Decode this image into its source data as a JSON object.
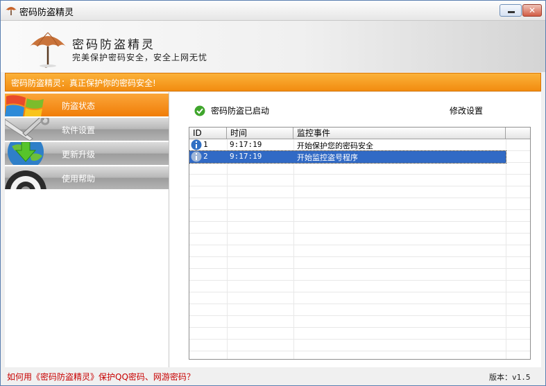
{
  "window": {
    "title": "密码防盗精灵"
  },
  "banner": {
    "title": "密码防盗精灵",
    "subtitle": "完美保护密码安全，安全上网无忧"
  },
  "notice_bar": {
    "text": "密码防盗精灵：真正保护你的密码安全!"
  },
  "sidebar": {
    "items": [
      {
        "label": "防盗状态",
        "active": true,
        "icon": "windows-flag-icon"
      },
      {
        "label": "软件设置",
        "active": false,
        "icon": "tools-wrench-icon"
      },
      {
        "label": "更新升级",
        "active": false,
        "icon": "globe-download-icon"
      },
      {
        "label": "使用帮助",
        "active": false,
        "icon": "help-lifebuoy-icon"
      }
    ]
  },
  "main": {
    "status_text": "密码防盗已启动",
    "modify_link": "修改设置",
    "table": {
      "headers": [
        "ID",
        "时间",
        "监控事件"
      ],
      "rows": [
        {
          "id": "1",
          "time": "9:17:19",
          "event": "开始保护您的密码安全",
          "selected": false
        },
        {
          "id": "2",
          "time": "9:17:19",
          "event": "开始监控盗号程序",
          "selected": true
        }
      ]
    }
  },
  "footer": {
    "help_link": "如何用《密码防盗精灵》保护QQ密码、网游密码？",
    "version": "版本：v1.5"
  },
  "colors": {
    "accent": "#f28c10",
    "selection": "#316ac5",
    "link": "#c80000"
  }
}
